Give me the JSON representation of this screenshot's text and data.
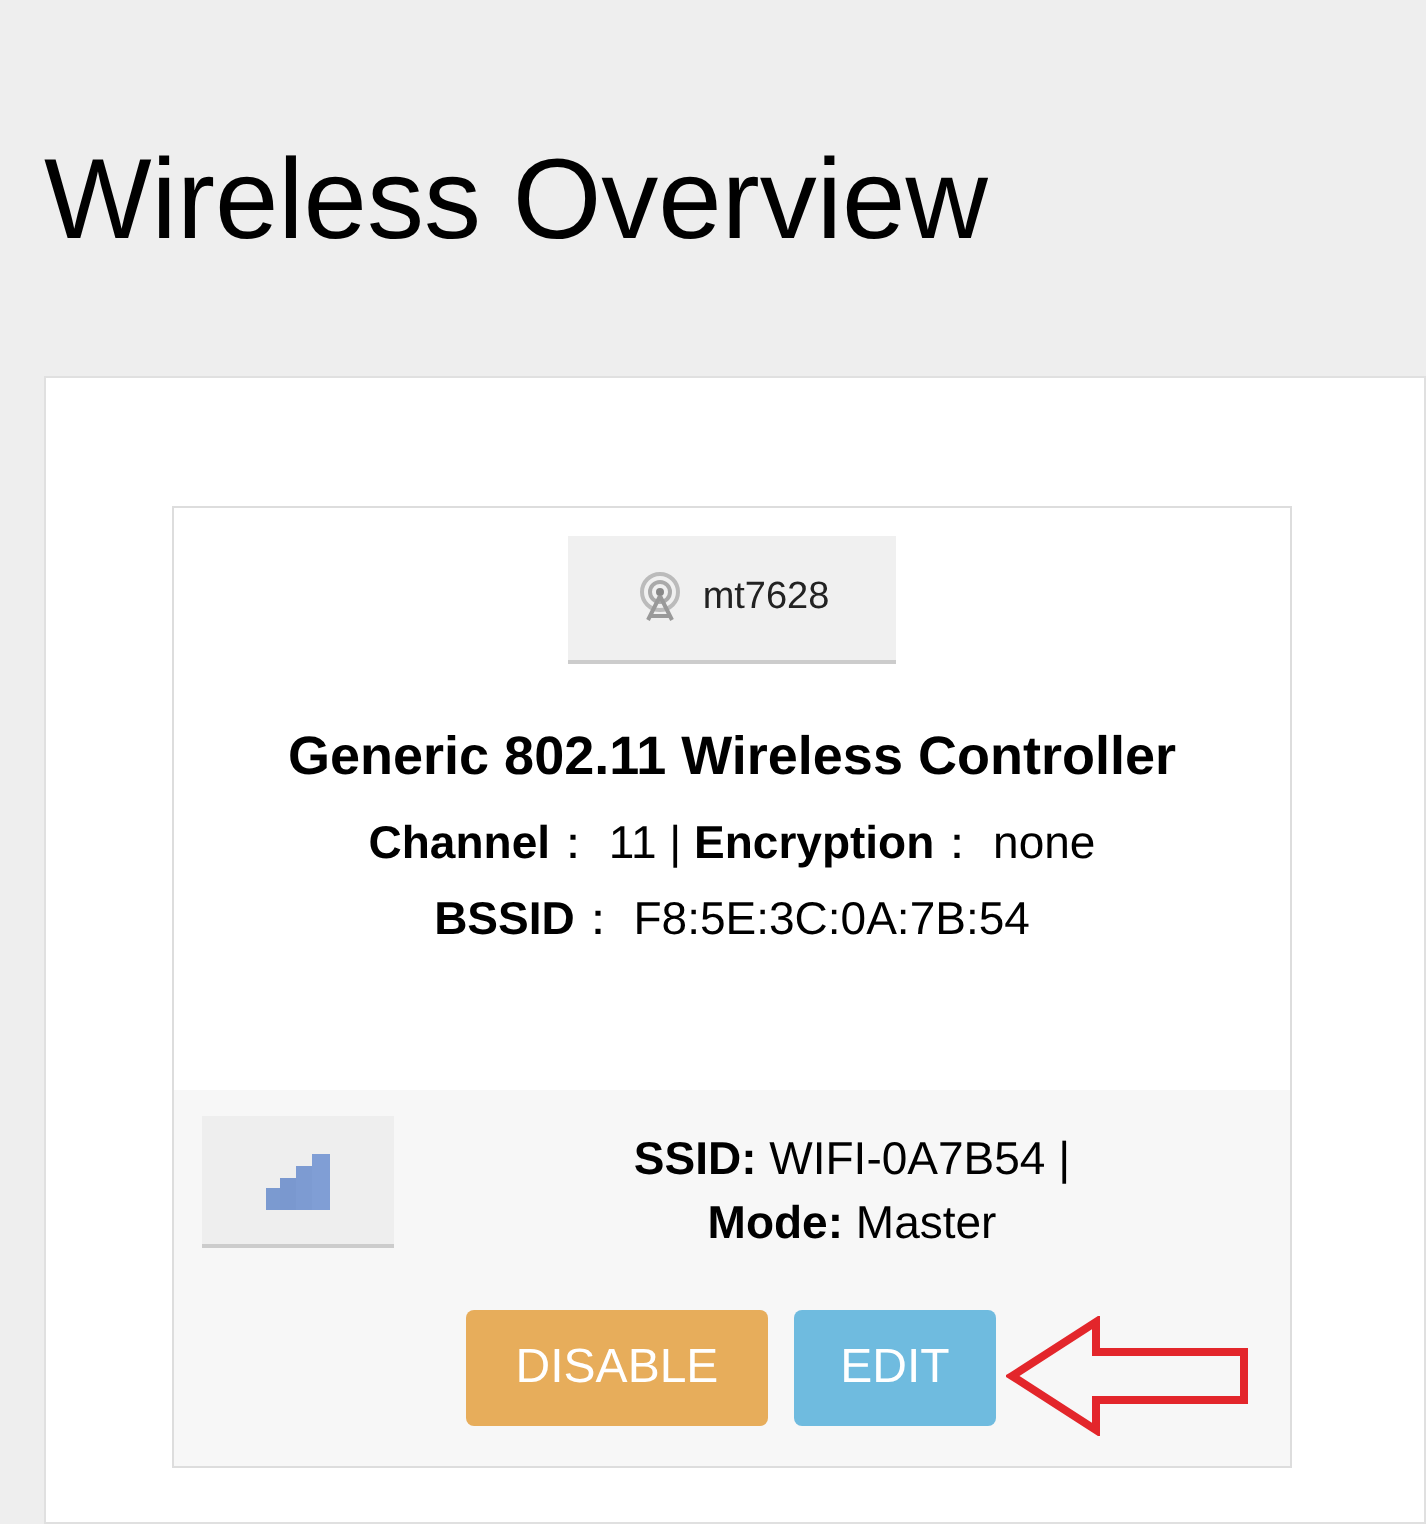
{
  "page_title": "Wireless Overview",
  "device": {
    "name": "mt7628",
    "description": "Generic 802.11 Wireless Controller",
    "details": [
      "**Channel**： 11 | **Encryption**： none",
      "**BSSID**： F8:5E:3C:0A:7B:54"
    ]
  },
  "network": {
    "info": [
      "**SSID:** WIFI-0A7B54 |",
      "**Mode:** Master"
    ],
    "buttons": [
      {
        "label": "DISABLE",
        "kind": "warning"
      },
      {
        "label": "EDIT",
        "kind": "info"
      }
    ]
  },
  "annotation": {
    "kind": "arrow"
  }
}
